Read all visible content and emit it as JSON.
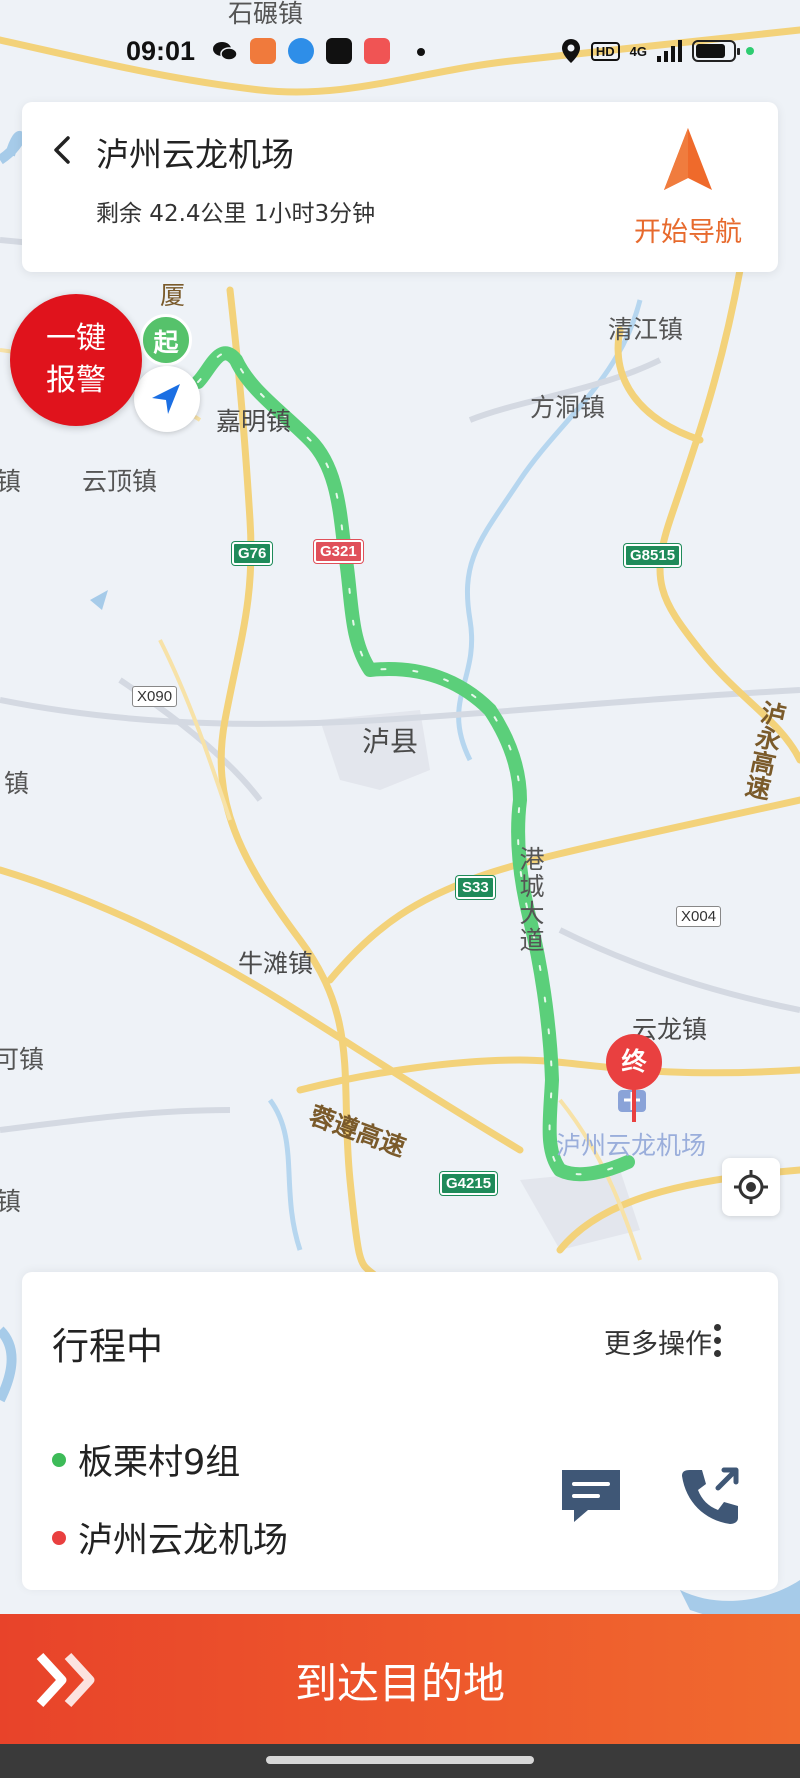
{
  "status_bar": {
    "time": "09:01",
    "network": "4G",
    "badge": "HD",
    "battery_level": 0.8
  },
  "header": {
    "destination": "泸州云龙机场",
    "remaining": "剩余 42.4公里 1小时3分钟",
    "start_nav_label": "开始导航",
    "accent_color": "#e76a2d"
  },
  "sos": {
    "line1": "一键",
    "line2": "报警"
  },
  "map": {
    "start_marker": "起",
    "end_marker": "终",
    "labels": {
      "shiwa": "石碾镇",
      "qingjiang": "清江镇",
      "fangdong": "方洞镇",
      "jiaming": "嘉明镇",
      "yunding": "云顶镇",
      "luxian": "泸县",
      "niutan": "牛滩镇",
      "yunlong": "云龙镇",
      "airport": "泸州云龙机场",
      "gangcheng": "港城大道",
      "rongzun": "蓉遵高速",
      "luyong": "泸永高速",
      "sha": "厦",
      "zhen_left1": "镇",
      "zhen_left2": "镇",
      "zhen_left3": "可镇",
      "zhen_left4": "镇"
    },
    "shields": {
      "g76": "G76",
      "g321": "G321",
      "g8515": "G8515",
      "x090": "X090",
      "s33": "S33",
      "x004": "X004",
      "g4215": "G4215"
    },
    "route_color": "#5bcf7a"
  },
  "trip": {
    "status": "行程中",
    "more_actions": "更多操作",
    "origin": "板栗村9组",
    "destination": "泸州云龙机场",
    "origin_color": "#3dbb58",
    "destination_color": "#e94040"
  },
  "footer": {
    "arrive_label": "到达目的地"
  },
  "icons": [
    "back-icon",
    "navigation-arrow-icon",
    "locate-icon",
    "more-dots-icon",
    "message-icon",
    "phone-icon",
    "double-chevron-icon"
  ]
}
